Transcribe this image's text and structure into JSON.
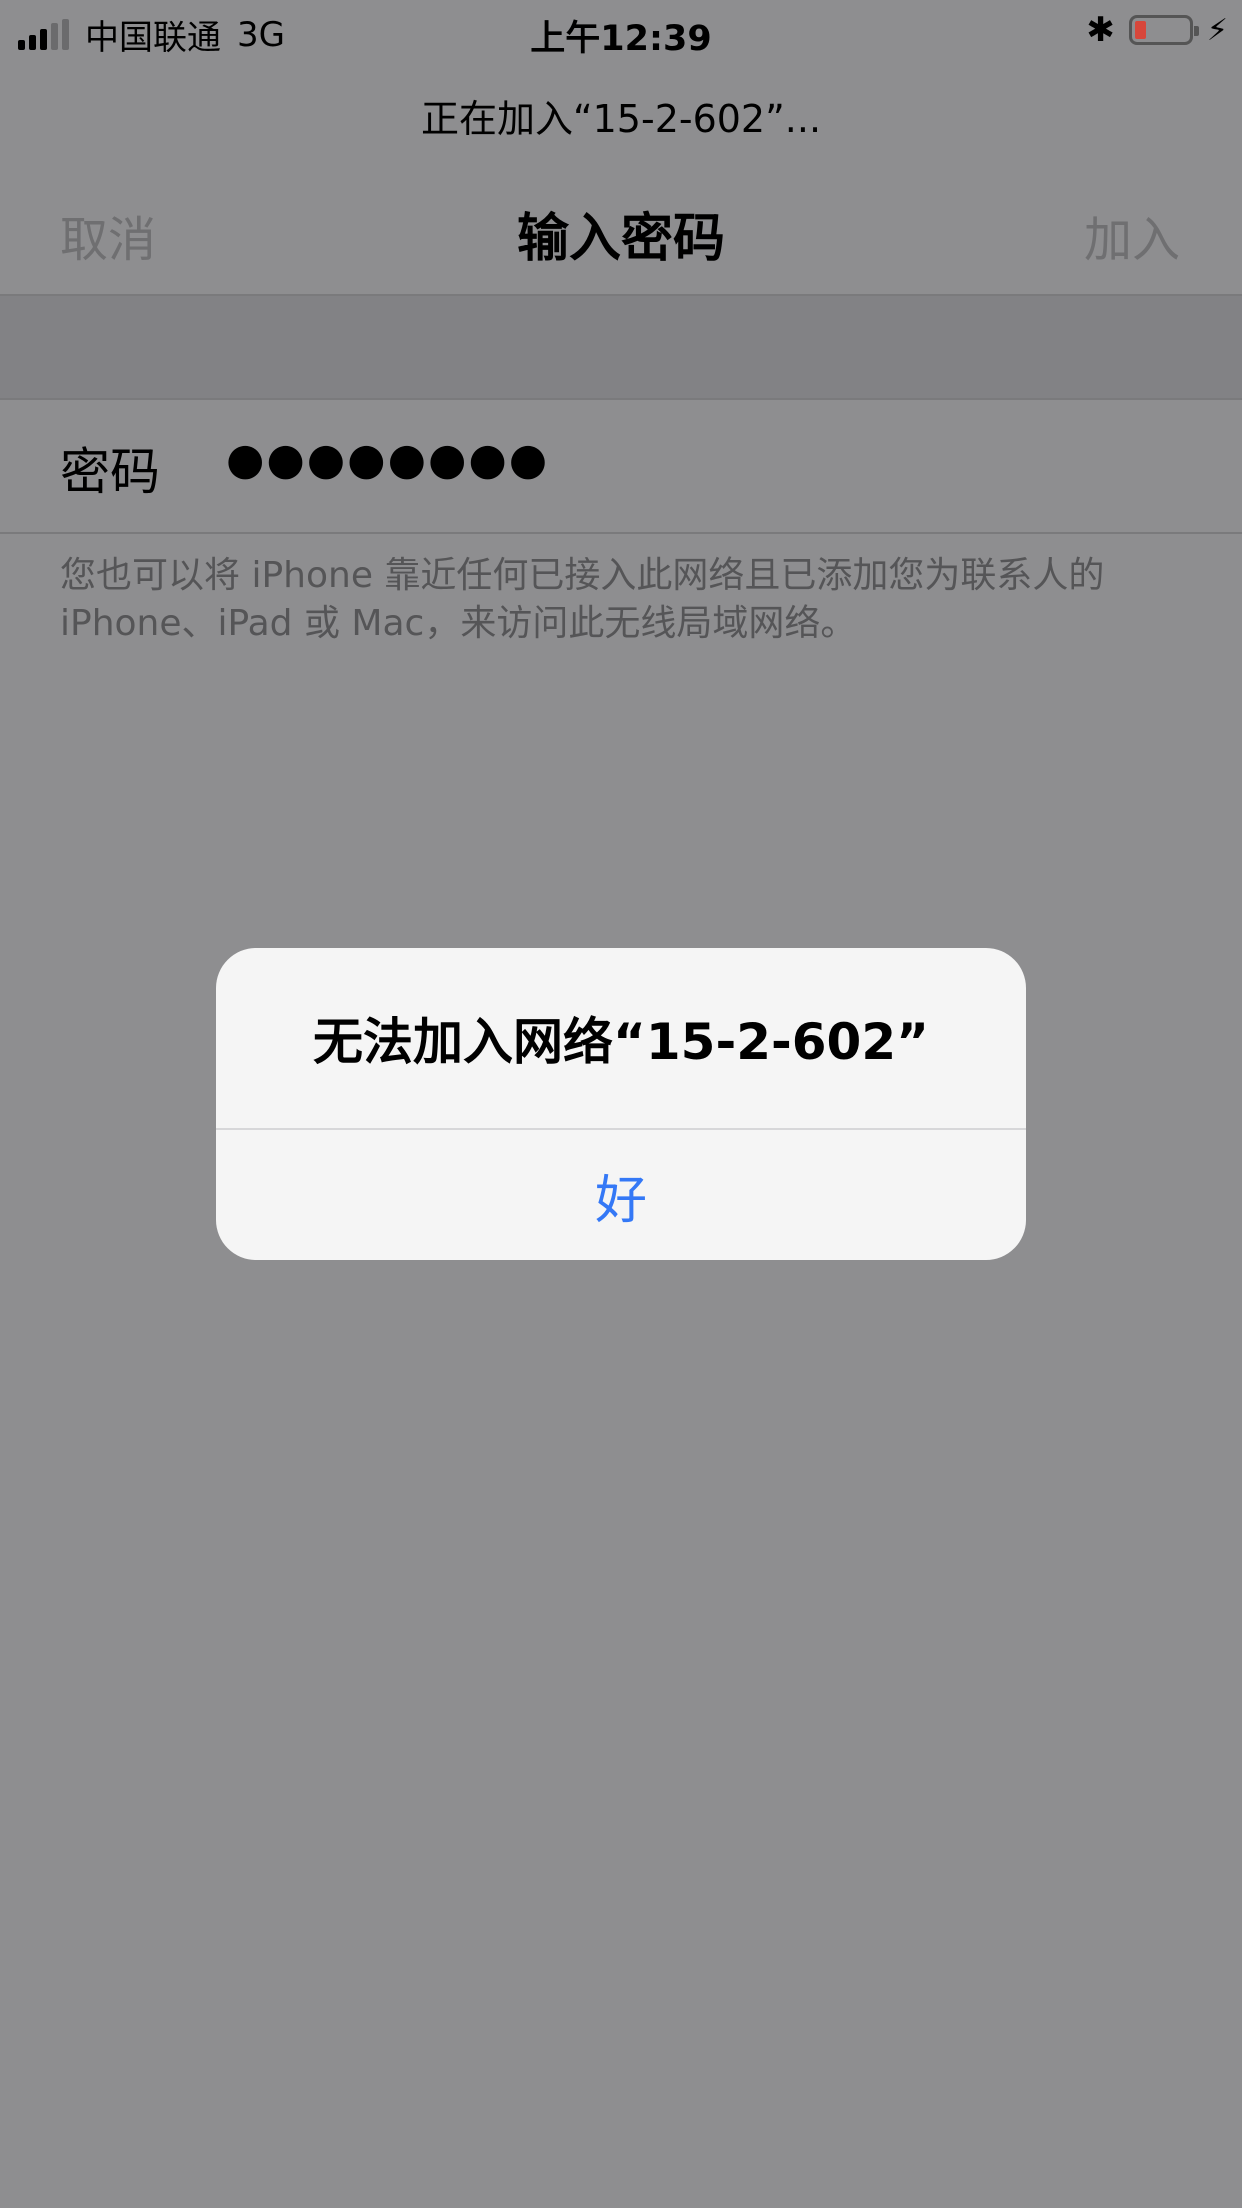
{
  "status_bar": {
    "carrier": "中国联通",
    "network": "3G",
    "time": "上午12:39",
    "icons": [
      "signal-icon",
      "bluetooth-icon",
      "battery-icon",
      "charging-icon"
    ],
    "battery_color": "#d8473b"
  },
  "header": {
    "joining_text": "正在加入“15-2-602”..."
  },
  "nav": {
    "cancel_label": "取消",
    "title": "输入密码",
    "join_label": "加入"
  },
  "form": {
    "password_label": "密码",
    "password_value": "●●●●●●●●"
  },
  "hint": {
    "text": "您也可以将 iPhone 靠近任何已接入此网络且已添加您为联系人的 iPhone、iPad 或 Mac，来访问此无线局域网络。"
  },
  "alert": {
    "title": "无法加入网络“15-2-602”",
    "button_label": "好",
    "button_color": "#3478f6"
  }
}
